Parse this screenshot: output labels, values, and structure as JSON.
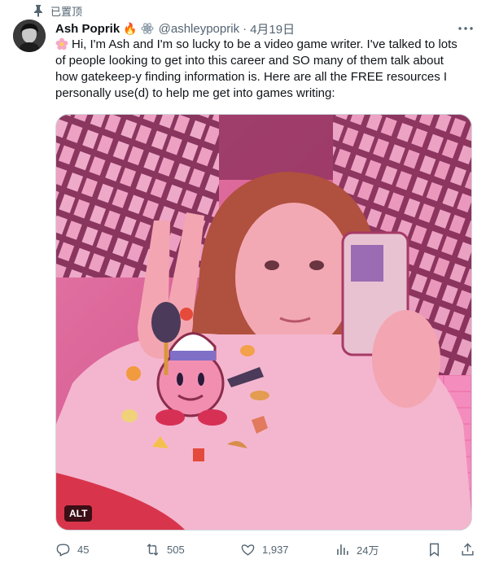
{
  "pinned": {
    "label": "已置顶"
  },
  "tweet": {
    "author_name": "Ash Poprik",
    "badge_emoji": "🔥",
    "handle": "@ashleypoprik",
    "separator": "·",
    "date": "4月19日",
    "text_lines": [
      "Hi, I'm Ash and I'm so lucky to be a video game writer. I've talked to lots",
      "of people looking to get into this career and SO many of them talk about",
      "how gatekeep-y finding information is. Here are all the FREE resources I",
      "personally use(d) to help me get into games writing:"
    ],
    "media": {
      "alt_label": "ALT"
    }
  },
  "actions": {
    "replies": "45",
    "retweets": "505",
    "likes": "1,937",
    "views": "24万"
  },
  "icons": [
    "pin-icon",
    "flame-icon",
    "atom-icon",
    "more-icon",
    "flower-icon",
    "reply-icon",
    "retweet-icon",
    "like-icon",
    "views-icon",
    "bookmark-icon",
    "share-icon"
  ],
  "colors": {
    "text": "#0f1419",
    "muted": "#536471",
    "media_tint": "#e96fa8"
  }
}
